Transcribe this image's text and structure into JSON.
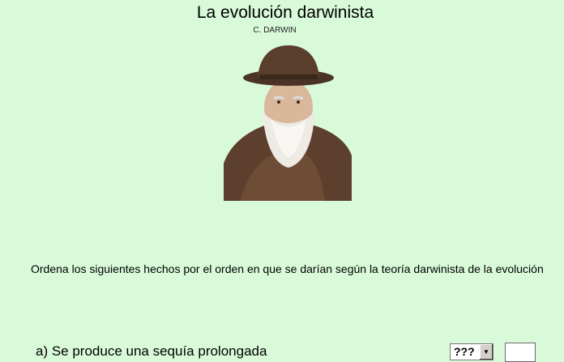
{
  "page": {
    "title": "La evolución darwinista",
    "portrait_caption": "C. DARWIN",
    "instructions": "Ordena los siguientes hechos por el orden en que se darían según la teoría darwinista de la evolución"
  },
  "items": [
    {
      "label": "a) Se produce una sequía prolongada",
      "selected": "???",
      "answer": ""
    }
  ],
  "colors": {
    "background": "#d9fad9"
  }
}
